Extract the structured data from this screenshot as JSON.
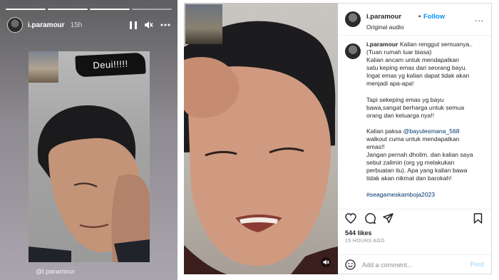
{
  "story": {
    "username": "i.paramour",
    "time": "15h",
    "sticker": "Deui!!!!!",
    "caption": "@i.paramour",
    "segments": 4,
    "done_segments": 3
  },
  "post": {
    "username": "i.paramour",
    "dot": "•",
    "follow_label": "Follow",
    "audio": "Original audio",
    "more": "...",
    "caption": {
      "username": "i.paramour",
      "line1": "Kalian renggut semuanya..",
      "line2": "(Tuan rumah luar biasa)",
      "line3": "Kalian ancam untuk mendapatkan",
      "line4": "satu keping emas dari seorang bayu.",
      "line5": "Ingat emas yg kalian dapat tidak akan",
      "line6": "menjadi apa-apa!",
      "line7": "Tapi sekeping emas yg bayu",
      "line8": "bawa,sangat berharga untuk semua",
      "line9": "orang dan keluarga nya!!",
      "line10_pre": "Kalian paksa ",
      "line10_mention": "@bayulesmana_568",
      "line11": "walkout cuma untuk mendapatkan",
      "line12": "emas!!",
      "line13": "Jangan pernah dholim. dan kalian saya",
      "line14": "sebut zalimin (org yg melakukan",
      "line15": "perbuatan itu). Apa yang kalian bawa",
      "line16": "tidak akan nikmat dan barokah!",
      "hashtag": "#seagameskamboja2023"
    },
    "likes": "544 likes",
    "posted": "15 HOURS AGO",
    "comment_placeholder": "Add a comment...",
    "post_label": "Post"
  },
  "colors": {
    "accent": "#0095f6",
    "link": "#00376b",
    "post_disabled": "#b2dffc"
  }
}
